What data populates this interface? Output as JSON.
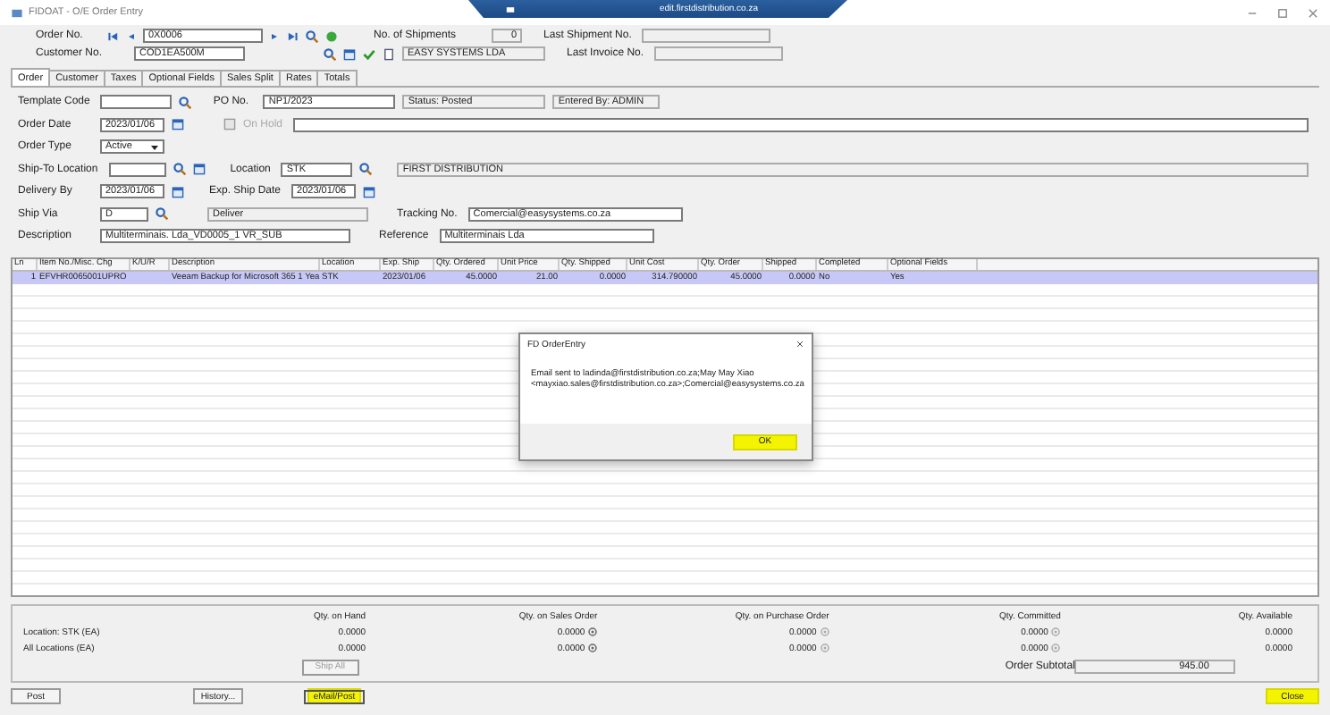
{
  "window": {
    "title": "FIDOAT - O/E Order Entry",
    "remote_host": "edit.firstdistribution.co.za"
  },
  "header": {
    "order_no": {
      "label": "Order No.",
      "value": "0X0006"
    },
    "shipments": {
      "label": "No. of Shipments",
      "value": "0"
    },
    "last_shipment": {
      "label": "Last Shipment No."
    },
    "customer_no": {
      "label": "Customer No.",
      "value": "COD1EA500M"
    },
    "customer_name": "EASY SYSTEMS LDA",
    "last_invoice": {
      "label": "Last Invoice No."
    }
  },
  "tabs": [
    {
      "label": "Order",
      "selected": true
    },
    {
      "label": "Customer",
      "selected": false
    },
    {
      "label": "Taxes",
      "selected": false
    },
    {
      "label": "Optional Fields",
      "selected": false
    },
    {
      "label": "Sales Split",
      "selected": false
    },
    {
      "label": "Rates",
      "selected": false
    },
    {
      "label": "Totals",
      "selected": false
    }
  ],
  "form": {
    "template_code": {
      "label": "Template Code"
    },
    "po_no": {
      "label": "PO No.",
      "value": "NP1/2023"
    },
    "status": "Status: Posted",
    "entered_by": "Entered By: ADMIN",
    "order_date": {
      "label": "Order Date",
      "value": "2023/01/06"
    },
    "on_hold": {
      "label": "On Hold",
      "checked": false,
      "disabled": true
    },
    "order_type": {
      "label": "Order Type",
      "value": "Active"
    },
    "ship_to": {
      "label": "Ship-To Location"
    },
    "location": {
      "label": "Location",
      "value": "STK",
      "name": "FIRST DISTRIBUTION"
    },
    "delivery_by": {
      "label": "Delivery By",
      "value": "2023/01/06"
    },
    "exp_ship": {
      "label": "Exp. Ship Date",
      "value": "2023/01/06"
    },
    "ship_via": {
      "label": "Ship Via",
      "value": "D",
      "name": "Deliver"
    },
    "tracking": {
      "label": "Tracking No.",
      "value": "Comercial@easysystems.co.za"
    },
    "description": {
      "label": "Description",
      "value": "Multiterminais. Lda_VD0005_1 VR_SUB"
    },
    "reference": {
      "label": "Reference",
      "value": "Multiterminais Lda"
    }
  },
  "table": {
    "columns": [
      "Ln",
      "Item No./Misc. Chg",
      "K/U/R",
      "Description",
      "Location",
      "Exp. Ship",
      "Qty. Ordered",
      "Unit Price",
      "Qty. Shipped",
      "Unit Cost",
      "Qty. Order",
      "Shipped",
      "Completed",
      "Optional Fields"
    ],
    "rows": [
      {
        "selected": true,
        "cells": [
          "1",
          "EFVHR0065001UPRO",
          "",
          "Veeam Backup for Microsoft 365 1 Yea",
          "STK",
          "2023/01/06",
          "45.0000",
          "21.00",
          "0.0000",
          "314.790000",
          "45.0000",
          "0.0000",
          "No",
          "Yes"
        ]
      }
    ]
  },
  "dialog": {
    "title": "FD OrderEntry",
    "message": "Email sent to ladinda@firstdistribution.co.za;May May Xiao <mayxiao.sales@firstdistribution.co.za>;Comercial@easysystems.co.za",
    "ok": {
      "label": "OK",
      "highlighted": true
    }
  },
  "stock": {
    "columns": [
      "Qty. on Hand",
      "Qty. on Sales Order",
      "Qty. on Purchase Order",
      "Qty. Committed",
      "Qty. Available"
    ],
    "rows": [
      {
        "label": "Location: STK (EA)",
        "values": [
          "0.0000",
          "0.0000",
          "0.0000",
          "0.0000",
          "0.0000"
        ]
      },
      {
        "label": "All Locations (EA)",
        "values": [
          "0.0000",
          "0.0000",
          "0.0000",
          "0.0000",
          "0.0000"
        ]
      }
    ],
    "ship_all": {
      "label": "Ship All",
      "disabled": true
    }
  },
  "subtotal": {
    "label": "Order Subtotal",
    "value": "945.00"
  },
  "buttons": [
    {
      "label": "Post",
      "highlighted": false
    },
    {
      "label": "History...",
      "highlighted": false
    },
    {
      "label": "eMail/Post",
      "highlighted": true
    },
    {
      "label": "Close",
      "highlighted": true
    }
  ]
}
